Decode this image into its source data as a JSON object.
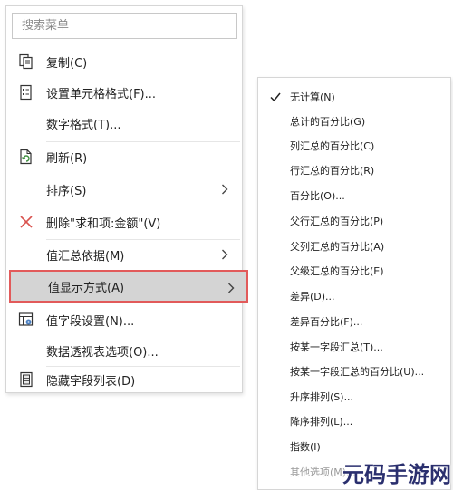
{
  "search": {
    "placeholder": "搜索菜单"
  },
  "menu": {
    "items": [
      {
        "label": "复制(C)",
        "icon": "copy-icon"
      },
      {
        "label": "设置单元格格式(F)...",
        "icon": "format-cells-icon"
      },
      {
        "label": "数字格式(T)...",
        "icon": ""
      },
      {
        "label": "刷新(R)",
        "icon": "refresh-icon"
      },
      {
        "label": "排序(S)",
        "icon": "",
        "submenu": true
      },
      {
        "label": "删除\"求和项:金额\"(V)",
        "icon": "delete-x-icon"
      },
      {
        "label": "值汇总依据(M)",
        "icon": "",
        "submenu": true
      },
      {
        "label": "值显示方式(A)",
        "icon": "",
        "submenu": true,
        "highlighted": true
      },
      {
        "label": "值字段设置(N)...",
        "icon": "field-settings-icon"
      },
      {
        "label": "数据透视表选项(O)...",
        "icon": ""
      },
      {
        "label": "隐藏字段列表(D)",
        "icon": "field-list-icon"
      }
    ]
  },
  "submenu": {
    "items": [
      {
        "label": "无计算(N)",
        "checked": true
      },
      {
        "label": "总计的百分比(G)"
      },
      {
        "label": "列汇总的百分比(C)"
      },
      {
        "label": "行汇总的百分比(R)"
      },
      {
        "label": "百分比(O)..."
      },
      {
        "label": "父行汇总的百分比(P)"
      },
      {
        "label": "父列汇总的百分比(A)"
      },
      {
        "label": "父级汇总的百分比(E)"
      },
      {
        "label": "差异(D)..."
      },
      {
        "label": "差异百分比(F)..."
      },
      {
        "label": "按某一字段汇总(T)..."
      },
      {
        "label": "按某一字段汇总的百分比(U)..."
      },
      {
        "label": "升序排列(S)..."
      },
      {
        "label": "降序排列(L)..."
      },
      {
        "label": "指数(I)"
      },
      {
        "label": "其他选项(M)...",
        "disabled": true
      }
    ]
  },
  "watermark": {
    "text": "元码手游网"
  },
  "colors": {
    "highlight_border": "#e25a5a",
    "highlight_bg": "#d4d4d4",
    "delete_red": "#d9534f",
    "refresh_green": "#3f8f3f",
    "watermark_navy": "#2a2f6e"
  }
}
